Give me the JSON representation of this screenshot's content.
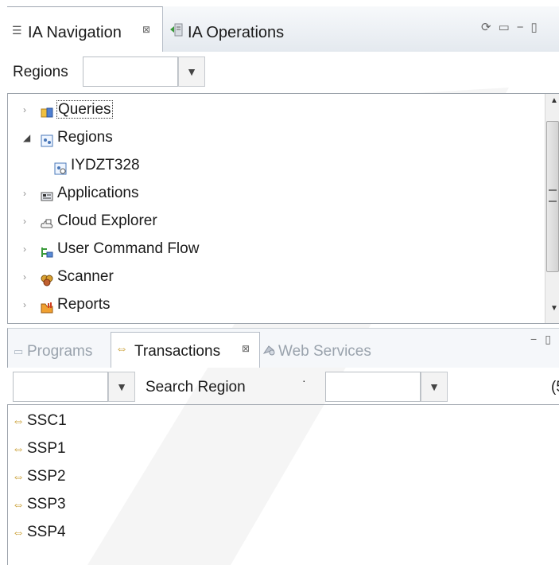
{
  "top_view": {
    "tabs": [
      {
        "label": "IA Navigation",
        "active": true,
        "close": "⊠"
      },
      {
        "label": "IA Operations",
        "active": false
      }
    ],
    "regions_label": "Regions",
    "regions_combo_value": "",
    "tree": [
      {
        "label": "Queries",
        "icon": "queries-icon",
        "expanded": false,
        "focused": true
      },
      {
        "label": "Regions",
        "icon": "regions-icon",
        "expanded": true
      },
      {
        "label": "IYDZT328",
        "icon": "region-icon",
        "child": true
      },
      {
        "label": "Applications",
        "icon": "applications-icon",
        "expanded": false
      },
      {
        "label": "Cloud Explorer",
        "icon": "cloud-explorer-icon",
        "expanded": false
      },
      {
        "label": "User Command Flow",
        "icon": "user-command-flow-icon",
        "expanded": false
      },
      {
        "label": "Scanner",
        "icon": "scanner-icon",
        "expanded": false
      },
      {
        "label": "Reports",
        "icon": "reports-icon",
        "expanded": false
      }
    ]
  },
  "bottom_view": {
    "tabs": [
      {
        "label": "Programs",
        "active": false
      },
      {
        "label": "Transactions",
        "active": true,
        "close": "⊠"
      },
      {
        "label": "Web Services",
        "active": false
      }
    ],
    "search_label": "Search Region",
    "combo_left_value": "",
    "combo_right_value": "",
    "cut_text": "(5",
    "transactions": [
      "SSC1",
      "SSP1",
      "SSP2",
      "SSP3",
      "SSP4"
    ]
  },
  "colors": {
    "accent_blue": "#2b6cb0",
    "transaction_icon": "#c79a2a",
    "watermark": "#e8e8e8"
  }
}
